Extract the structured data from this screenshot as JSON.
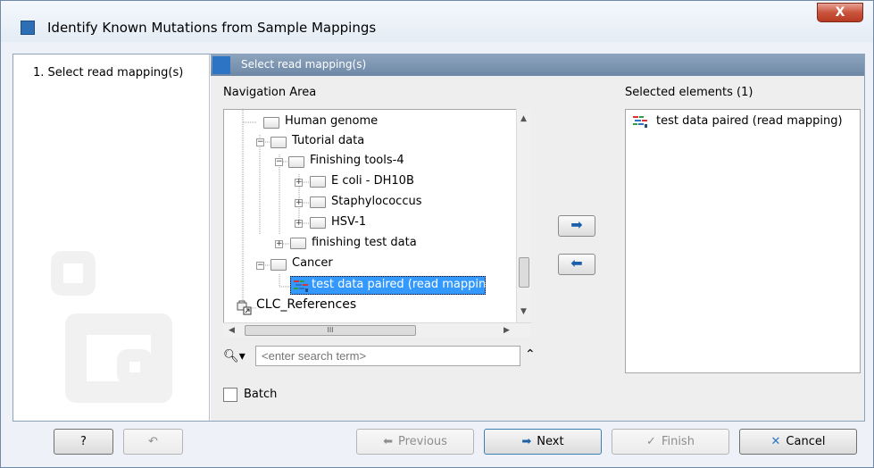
{
  "window": {
    "title": "Identify Known Mutations from Sample Mappings",
    "close_label": "X"
  },
  "steps": [
    {
      "label": "1.  Select read mapping(s)"
    }
  ],
  "panel": {
    "header": "Select read mapping(s)",
    "nav_label": "Navigation Area",
    "selected_label": "Selected elements (1)"
  },
  "tree": [
    {
      "label": "Human genome"
    },
    {
      "label": "Tutorial data"
    },
    {
      "label": "Finishing tools-4"
    },
    {
      "label": "E coli - DH10B"
    },
    {
      "label": "Staphylococcus"
    },
    {
      "label": "HSV-1"
    },
    {
      "label": "finishing test data"
    },
    {
      "label": "Cancer"
    },
    {
      "label": "test data paired (read mapping)"
    },
    {
      "label": "CLC_References"
    }
  ],
  "hscroll_grip": "III",
  "search": {
    "placeholder": "<enter search term>"
  },
  "selected_items": [
    {
      "label": "test data paired (read mapping)"
    }
  ],
  "batch": {
    "label": "Batch",
    "checked": false
  },
  "buttons": {
    "help": "?",
    "previous": "Previous",
    "next": "Next",
    "finish": "Finish",
    "cancel": "Cancel"
  },
  "colors": {
    "selection": "#3399ff",
    "header": "#7a92b0",
    "accent": "#2d74c4"
  }
}
